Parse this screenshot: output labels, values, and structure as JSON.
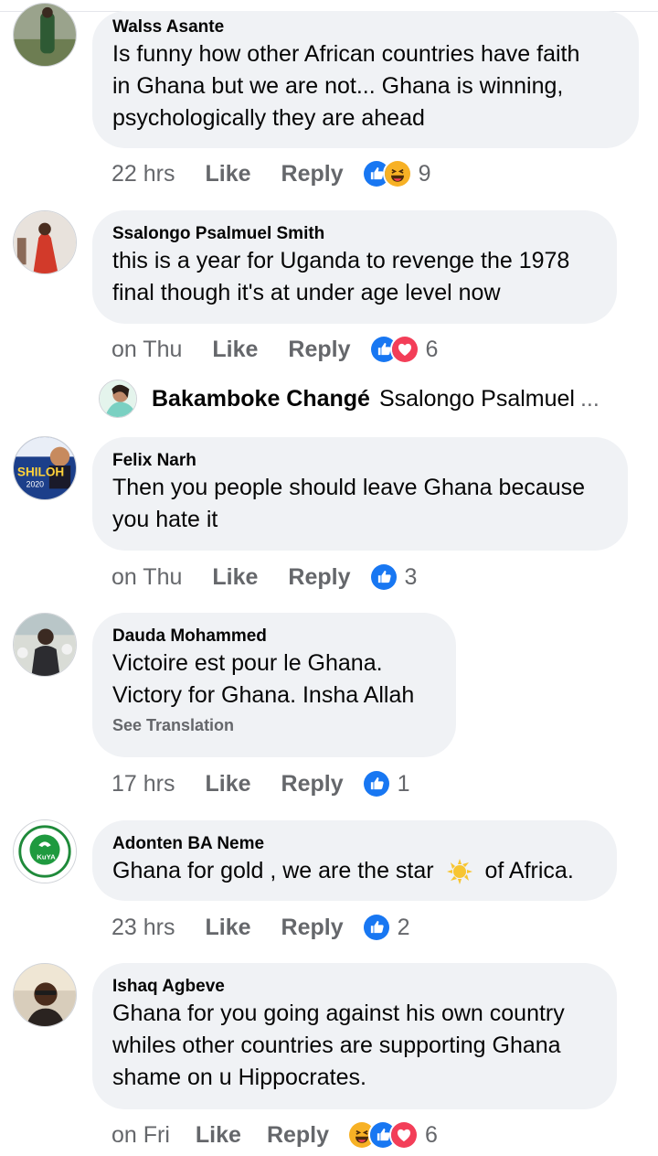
{
  "comments": [
    {
      "author": "Walss Asante",
      "lines": [
        "Is funny how other African countries have faith",
        "in Ghana but we are not... Ghana is winning,",
        "psychologically they are ahead"
      ],
      "time": "22 hrs",
      "like": "Like",
      "reply": "Reply",
      "count": "9",
      "reactions": [
        "like-icon",
        "haha-icon"
      ]
    },
    {
      "author": "Ssalongo Psalmuel Smith",
      "lines": [
        "this is a year for Uganda to revenge the 1978",
        "final though it's at under age level now"
      ],
      "time": "on Thu",
      "like": "Like",
      "reply": "Reply",
      "count": "6",
      "reactions": [
        "like-icon",
        "love-icon"
      ]
    },
    {
      "author": "Felix Narh",
      "lines": [
        "Then you people should leave Ghana because",
        "you hate it"
      ],
      "time": "on Thu",
      "like": "Like",
      "reply": "Reply",
      "count": "3",
      "reactions": [
        "like-icon"
      ]
    },
    {
      "author": "Dauda Mohammed",
      "lines": [
        "Victoire est pour le Ghana.",
        "Victory for Ghana. Insha Allah"
      ],
      "see_translation": "See Translation",
      "time": "17 hrs",
      "like": "Like",
      "reply": "Reply",
      "count": "1",
      "reactions": [
        "like-icon"
      ]
    },
    {
      "author": "Adonten BA Neme",
      "lines": [
        "Ghana for gold , we are the star",
        "of Africa."
      ],
      "time": "23 hrs",
      "like": "Like",
      "reply": "Reply",
      "count": "2",
      "reactions": [
        "like-icon"
      ]
    },
    {
      "author": "Ishaq Agbeve",
      "lines": [
        "Ghana for you going against his own country",
        "whiles other countries are supporting Ghana",
        "shame on u Hippocrates."
      ],
      "time": "on Fri",
      "like": "Like",
      "reply": "Reply",
      "count": "6",
      "reactions": [
        "haha-icon",
        "like-icon",
        "love-icon"
      ]
    }
  ],
  "reply_preview": {
    "author": "Bakamboke Changé",
    "text": "Ssalongo Psalmuel",
    "ellipsis": "..."
  },
  "avatar_texts": {
    "felix": "SHILOH",
    "felix_year": "2020",
    "adonten": "KuYA"
  },
  "colors": {
    "like_blue": "#1877f2",
    "love_red": "#f33e58",
    "haha_yellow": "#f7b125",
    "bubble": "#f0f2f5",
    "meta_gray": "#65676b"
  }
}
